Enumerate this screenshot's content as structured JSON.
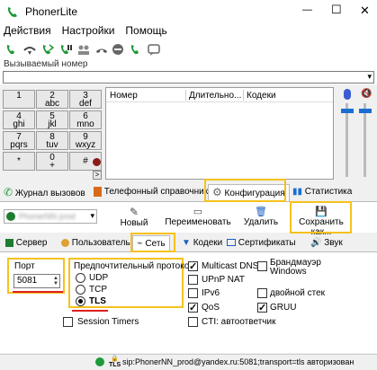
{
  "window": {
    "title": "PhonerLite",
    "minimize": "—",
    "maximize": "☐",
    "close": "✕"
  },
  "menu": [
    "Действия",
    "Настройки",
    "Помощь"
  ],
  "callee": {
    "label": "Вызываемый номер",
    "value": ""
  },
  "keypad": [
    {
      "num": "1",
      "sub": ""
    },
    {
      "num": "2",
      "sub": "abc"
    },
    {
      "num": "3",
      "sub": "def"
    },
    {
      "num": "4",
      "sub": "ghi"
    },
    {
      "num": "5",
      "sub": "jkl"
    },
    {
      "num": "6",
      "sub": "mno"
    },
    {
      "num": "7",
      "sub": "pqrs"
    },
    {
      "num": "8",
      "sub": "tuv"
    },
    {
      "num": "9",
      "sub": "wxyz"
    },
    {
      "num": "*",
      "sub": ""
    },
    {
      "num": "0",
      "sub": "+"
    },
    {
      "num": "#",
      "sub": ""
    }
  ],
  "keypad_expand": ">",
  "calls_table": {
    "columns": [
      "Номер",
      "Длительно...",
      "Кодеки"
    ]
  },
  "main_tabs": [
    "Журнал вызовов",
    "Телефонный справочник",
    "Конфигурация",
    "Статистика"
  ],
  "profile": {
    "value": "PhonerNN prod"
  },
  "actions": [
    "Новый",
    "Переименовать",
    "Удалить",
    "Сохранить как..."
  ],
  "config_tabs": [
    "Сервер",
    "Пользователь",
    "Сеть",
    "Кодеки",
    "Сертификаты",
    "Звук"
  ],
  "network": {
    "port_label": "Порт",
    "port_value": "5081",
    "protocol_label": "Предпочтительный протокол",
    "protocols": [
      {
        "label": "UDP",
        "selected": false
      },
      {
        "label": "TCP",
        "selected": false
      },
      {
        "label": "TLS",
        "selected": true
      }
    ],
    "session_timers": {
      "label": "Session Timers",
      "checked": false
    },
    "options_col1": [
      {
        "label": "Multicast DNS",
        "checked": true
      },
      {
        "label": "UPnP NAT",
        "checked": false
      },
      {
        "label": "IPv6",
        "checked": false
      },
      {
        "label": "QoS",
        "checked": true
      },
      {
        "label": "CTI: автоответчик",
        "checked": false
      }
    ],
    "options_col2": [
      {
        "label": "Брандмауэр Windows",
        "checked": false
      },
      {
        "label": "двойной стек",
        "checked": false
      },
      {
        "label": "GRUU",
        "checked": true
      }
    ]
  },
  "status": {
    "tls": "TLS",
    "text": "sip:PhonerNN_prod@yandex.ru:5081;transport=tls авторизован"
  },
  "colors": {
    "highlight": "#f6c21b",
    "underline": "#e02020",
    "accent": "#1e7d2f"
  }
}
